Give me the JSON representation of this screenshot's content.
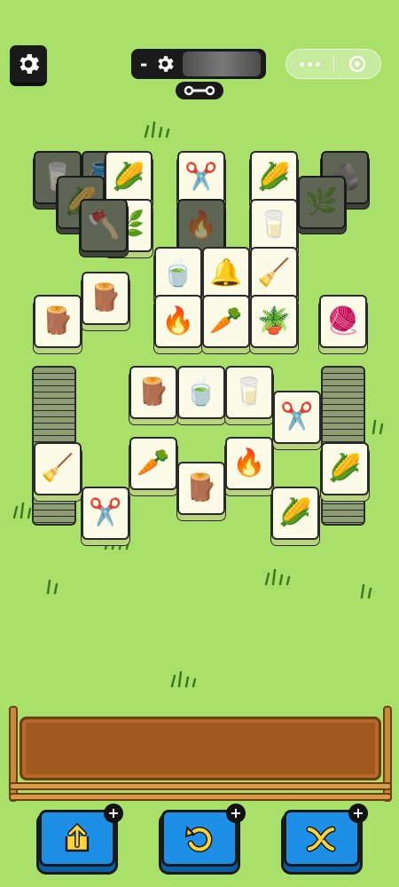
{
  "topbar": {
    "settings_icon": "gear-icon",
    "level_minus": "-",
    "level_icon": "gear-icon",
    "link_icon": "chain-link-icon",
    "menu_more_icon": "more-dots-icon",
    "menu_close_icon": "target-circle-icon"
  },
  "tiles": [
    {
      "icon": "🥛",
      "state": "dim"
    },
    {
      "icon": "🪣",
      "state": "dim"
    },
    {
      "icon": "🌽",
      "state": "top"
    },
    {
      "icon": "✂️",
      "state": "top"
    },
    {
      "icon": "🌽",
      "state": "top"
    },
    {
      "icon": "🪨",
      "state": "dim"
    },
    {
      "icon": "🌽",
      "state": "dim"
    },
    {
      "icon": "🌿",
      "state": "top"
    },
    {
      "icon": "🥛",
      "state": "top"
    },
    {
      "icon": "🌿",
      "state": "dim"
    },
    {
      "icon": "🪓",
      "state": "dim"
    },
    {
      "icon": "🔥",
      "state": "dim"
    },
    {
      "icon": "🍵",
      "state": "top"
    },
    {
      "icon": "🔔",
      "state": "top"
    },
    {
      "icon": "🧹",
      "state": "top"
    },
    {
      "icon": "🪵",
      "state": "top"
    },
    {
      "icon": "🔥",
      "state": "top"
    },
    {
      "icon": "🥕",
      "state": "top"
    },
    {
      "icon": "🪴",
      "state": "top"
    },
    {
      "icon": "🧶",
      "state": "top"
    },
    {
      "icon": "🪵",
      "state": "top"
    },
    {
      "icon": "🍵",
      "state": "top"
    },
    {
      "icon": "🥛",
      "state": "top"
    },
    {
      "icon": "🪵",
      "state": "top"
    },
    {
      "icon": "✂️",
      "state": "top"
    },
    {
      "icon": "🧹",
      "state": "top"
    },
    {
      "icon": "🥕",
      "state": "top"
    },
    {
      "icon": "🔥",
      "state": "top"
    },
    {
      "icon": "🌽",
      "state": "top"
    },
    {
      "icon": "🪵",
      "state": "top"
    },
    {
      "icon": "✂️",
      "state": "top"
    },
    {
      "icon": "🌽",
      "state": "top"
    }
  ],
  "tray": {
    "label": ""
  },
  "buttons": [
    {
      "name": "undo-out-button",
      "icon": "box-up-arrow-icon",
      "plus": "+"
    },
    {
      "name": "undo-button",
      "icon": "undo-arrow-icon",
      "plus": "+"
    },
    {
      "name": "shuffle-button",
      "icon": "shuffle-arrows-icon",
      "plus": "+"
    }
  ],
  "colors": {
    "background": "#a8e06a",
    "tile_top": "#fbfbe8",
    "tile_dim": "#8e9e74",
    "button": "#1e8fe6",
    "tray_wood": "#a0581f"
  }
}
